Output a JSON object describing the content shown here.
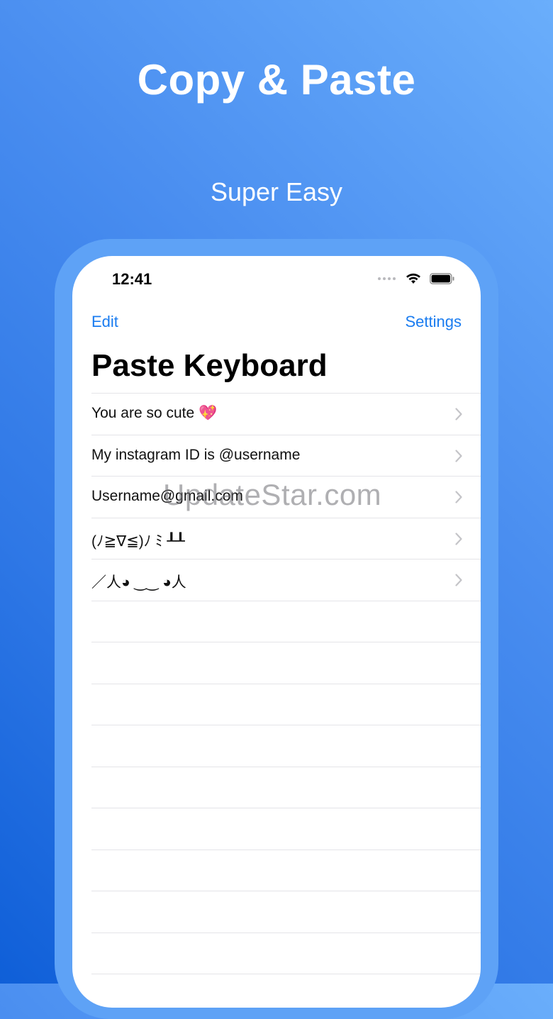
{
  "hero": {
    "title": "Copy & Paste",
    "subtitle": "Super Easy"
  },
  "status_bar": {
    "time": "12:41",
    "icons": [
      "signal-dots-icon",
      "wifi-icon",
      "battery-icon"
    ]
  },
  "nav": {
    "edit_label": "Edit",
    "settings_label": "Settings"
  },
  "page": {
    "title": "Paste Keyboard"
  },
  "list": {
    "items": [
      {
        "label": "You are so cute 💖"
      },
      {
        "label": "My instagram ID is @username"
      },
      {
        "label": "Username@gmail.com"
      },
      {
        "label": "(ﾉ≧∇≦)ﾉ ﾐ ┸┸"
      },
      {
        "label": "／人◕ ‿‿ ◕人"
      }
    ],
    "empty_rows": 9
  },
  "watermark": {
    "text": "UpdateStar.com"
  },
  "colors": {
    "accent": "#1a7cf0",
    "background_light": "#6aaefb",
    "background_dark": "#0f5fd8",
    "phone_frame": "#5ea2f6"
  }
}
